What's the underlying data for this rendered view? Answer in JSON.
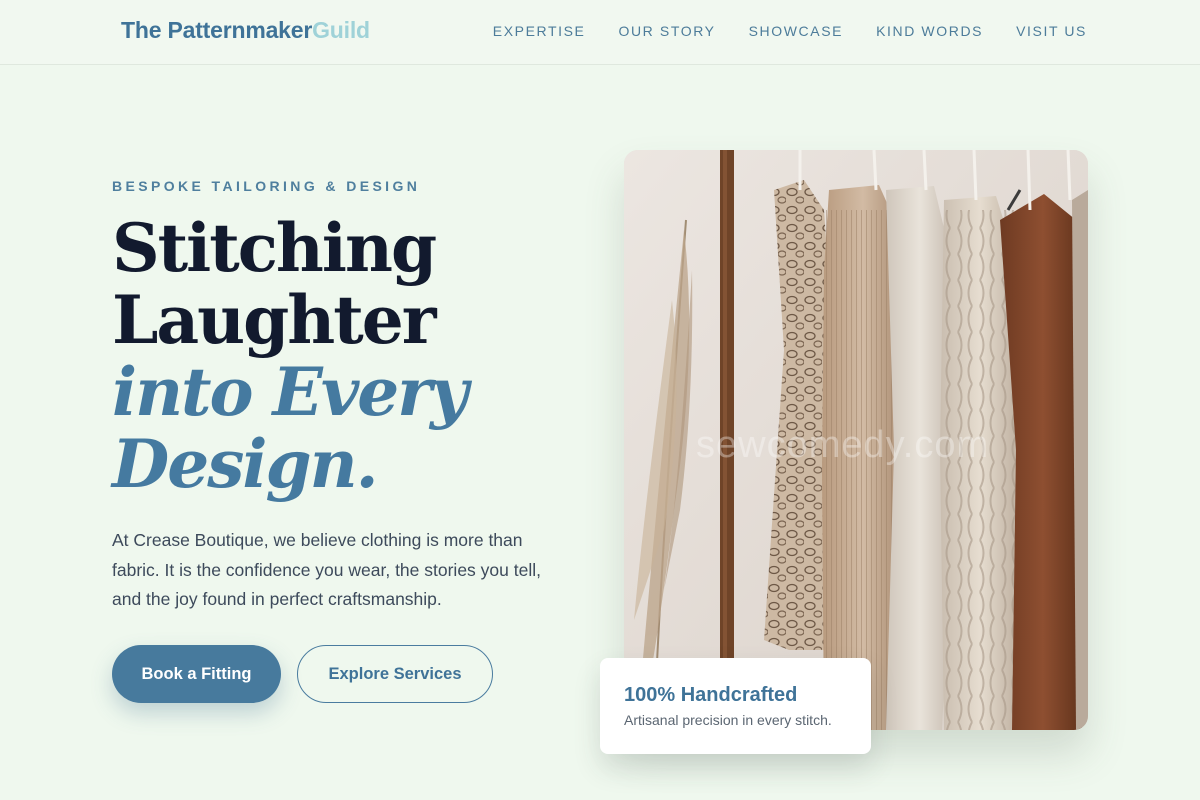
{
  "nav": {
    "logo_main": "The Patternmaker",
    "logo_accent": "Guild",
    "links": [
      "EXPERTISE",
      "OUR STORY",
      "SHOWCASE",
      "KIND WORDS",
      "VISIT US"
    ]
  },
  "hero": {
    "eyebrow": "BESPOKE TAILORING & DESIGN",
    "headline_line1": "Stitching",
    "headline_line2": "Laughter",
    "headline_line3": "into Every",
    "headline_line4": "Design.",
    "lede": "At Crease Boutique, we believe clothing is more than fabric. It is the confidence you wear, the stories you tell, and the joy found in perfect craftsmanship.",
    "primary_button": "Book a Fitting",
    "secondary_button": "Explore Services"
  },
  "image": {
    "watermark": "sewcomedy.com"
  },
  "badge": {
    "title": "100% Handcrafted",
    "subtitle": "Artisanal precision in every stitch."
  },
  "colors": {
    "background": "#eff8ee",
    "accent": "#477a9d",
    "logo_accent": "#9fd2d8",
    "headline": "#121a2e"
  }
}
